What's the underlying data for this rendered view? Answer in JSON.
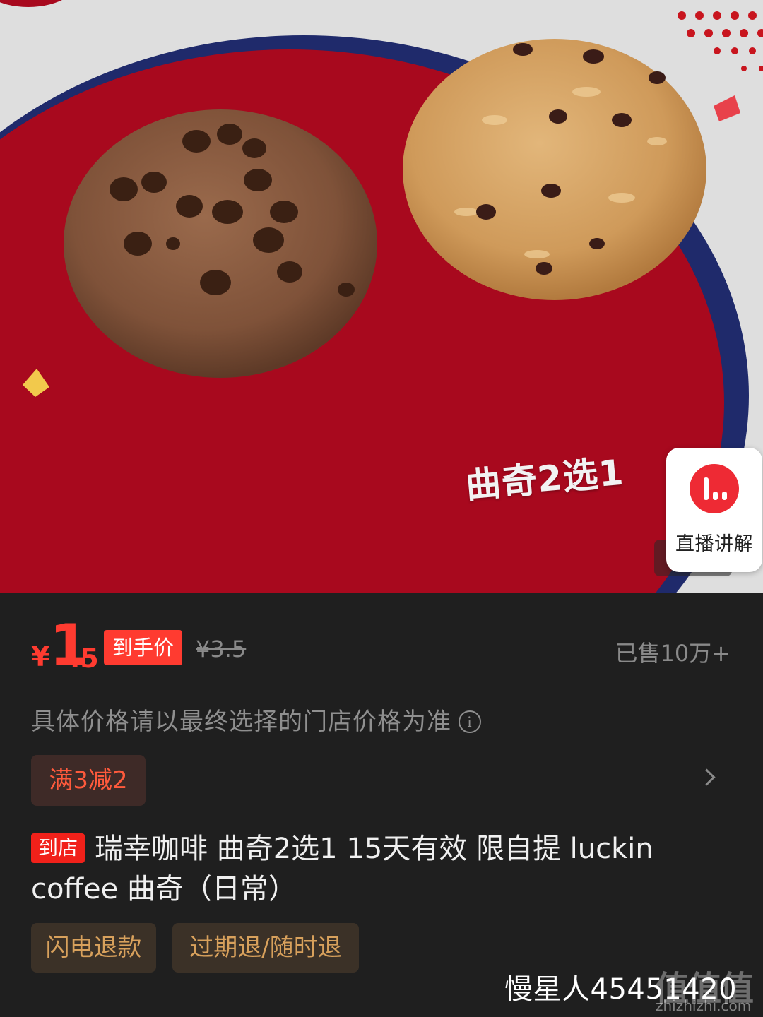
{
  "hero": {
    "caption": "曲奇2选1",
    "live_button_label": "直播讲解"
  },
  "price": {
    "currency": "¥",
    "integer": "1",
    "decimal": ".5",
    "tag": "到手价",
    "original": "¥3.5",
    "sold": "已售10万+"
  },
  "note": {
    "text": "具体价格请以最终选择的门店价格为准",
    "icon": "info-icon"
  },
  "promo": {
    "label": "满3减2"
  },
  "product": {
    "badge": "到店",
    "title": "瑞幸咖啡 曲奇2选1 15天有效 限自提 luckin coffee 曲奇（日常）"
  },
  "tags": [
    "闪电退款",
    "过期退/随时退"
  ],
  "watermark": {
    "user": "慢星人45451420",
    "logo": "值值值",
    "url": "zhizhizhi.com"
  },
  "colors": {
    "accent_red": "#ff3b30",
    "badge_red": "#f1211a",
    "tag_gold": "#d8a15c",
    "background": "#1f1f1f"
  }
}
